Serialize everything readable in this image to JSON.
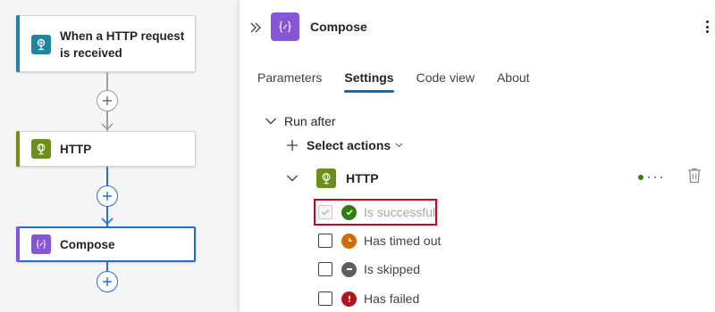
{
  "canvas": {
    "trigger": {
      "label": "When a HTTP request is received",
      "icon": "web-request-icon",
      "color": "#1f85a0"
    },
    "http": {
      "label": "HTTP",
      "icon": "globe-icon",
      "color": "#6b8f18"
    },
    "compose": {
      "label": "Compose",
      "icon": "compose-braces-icon",
      "color": "#8656d6",
      "selected": true
    },
    "add_buttons": [
      {
        "icon": "plus-icon"
      },
      {
        "icon": "plus-icon"
      },
      {
        "icon": "plus-icon"
      }
    ]
  },
  "panel": {
    "title": "Compose",
    "title_icon": "compose-braces-icon",
    "tabs": [
      {
        "label": "Parameters",
        "active": false
      },
      {
        "label": "Settings",
        "active": true
      },
      {
        "label": "Code view",
        "active": false
      },
      {
        "label": "About",
        "active": false
      }
    ],
    "run_after": {
      "label": "Run after",
      "select_actions_label": "Select actions",
      "action": {
        "label": "HTTP",
        "icon": "globe-icon",
        "conditions": [
          {
            "label": "Is successful",
            "checked": true,
            "disabled": true,
            "icon": "check-circle-icon",
            "color": "#2e7d12"
          },
          {
            "label": "Has timed out",
            "checked": false,
            "disabled": false,
            "icon": "clock-icon",
            "color": "#d06c00"
          },
          {
            "label": "Is skipped",
            "checked": false,
            "disabled": false,
            "icon": "minus-circle-icon",
            "color": "#5e5e5e"
          },
          {
            "label": "Has failed",
            "checked": false,
            "disabled": false,
            "icon": "error-circle-icon",
            "color": "#b3141c"
          }
        ]
      }
    }
  },
  "colors": {
    "accent": "#0f6cbd",
    "highlight": "#d0021b",
    "selected_border": "#1f6ed6"
  }
}
